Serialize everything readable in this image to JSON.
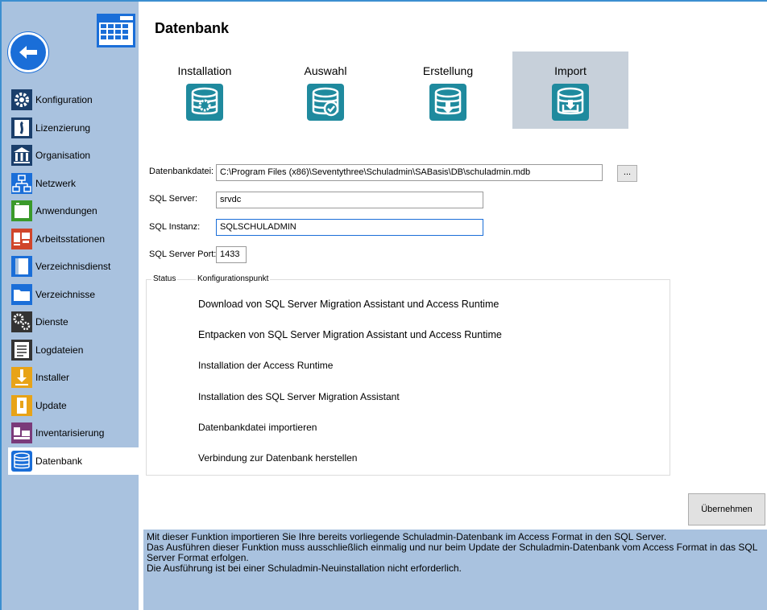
{
  "sidebar": {
    "back_icon": "back-arrow-icon",
    "calendar_icon": "calendar-icon",
    "items": [
      {
        "label": "Konfiguration",
        "icon": "gear-icon",
        "color": "#1a3e6b"
      },
      {
        "label": "Lizenzierung",
        "icon": "license-icon",
        "color": "#1a3e6b"
      },
      {
        "label": "Organisation",
        "icon": "building-icon",
        "color": "#1a3e6b"
      },
      {
        "label": "Netzwerk",
        "icon": "network-icon",
        "color": "#1a6ed8"
      },
      {
        "label": "Anwendungen",
        "icon": "application-window-icon",
        "color": "#3a9a2a"
      },
      {
        "label": "Arbeitsstationen",
        "icon": "workstation-icon",
        "color": "#d0452a"
      },
      {
        "label": "Verzeichnisdienst",
        "icon": "directory-service-icon",
        "color": "#1a6ed8"
      },
      {
        "label": "Verzeichnisse",
        "icon": "folder-icon",
        "color": "#1a6ed8"
      },
      {
        "label": "Dienste",
        "icon": "services-gears-icon",
        "color": "#333333"
      },
      {
        "label": "Logdateien",
        "icon": "log-file-icon",
        "color": "#333333"
      },
      {
        "label": "Installer",
        "icon": "installer-icon",
        "color": "#e8a317"
      },
      {
        "label": "Update",
        "icon": "update-icon",
        "color": "#e8a317"
      },
      {
        "label": "Inventarisierung",
        "icon": "inventory-icon",
        "color": "#7a3a7a"
      },
      {
        "label": "Datenbank",
        "icon": "database-icon",
        "color": "#1a6ed8"
      }
    ],
    "active_index": 13
  },
  "main": {
    "title": "Datenbank",
    "tabs": [
      {
        "label": "Installation",
        "icon": "database-gear-icon"
      },
      {
        "label": "Auswahl",
        "icon": "database-check-icon"
      },
      {
        "label": "Erstellung",
        "icon": "database-create-icon"
      },
      {
        "label": "Import",
        "icon": "database-import-icon"
      }
    ],
    "active_tab": "Import",
    "form": {
      "db_file_label": "Datenbankdatei:",
      "db_file_value": "C:\\Program Files (x86)\\Seventythree\\Schuladmin\\SABasis\\DB\\schuladmin.mdb",
      "browse_label": "...",
      "server_label": "SQL Server:",
      "server_value": "srvdc",
      "instance_label": "SQL Instanz:",
      "instance_value": "SQLSCHULADMIN",
      "port_label": "SQL Server Port:",
      "port_value": "1433"
    },
    "status_group": {
      "col_status": "Status",
      "col_point": "Konfigurationspunkt",
      "steps": [
        "Download von SQL Server Migration Assistant und Access Runtime",
        "Entpacken von SQL Server Migration Assistant und Access Runtime",
        "Installation der Access Runtime",
        "Installation des SQL Server Migration Assistant",
        "Datenbankdatei importieren",
        "Verbindung zur Datenbank herstellen"
      ]
    },
    "apply_label": "Übernehmen",
    "info_lines": [
      "Mit dieser Funktion importieren Sie Ihre bereits vorliegende Schuladmin-Datenbank im Access Format in den SQL Server.",
      "Das Ausführen dieser Funktion muss ausschließlich einmalig und nur beim Update der Schuladmin-Datenbank vom Access Format in das SQL Server Format erfolgen.",
      "Die Ausführung ist bei einer Schuladmin-Neuinstallation nicht erforderlich."
    ]
  },
  "colors": {
    "sidebar_bg": "#a9c2df",
    "accent": "#1a6ed8",
    "db_icon_teal": "#1f8a9e",
    "active_tab_bg": "#c7d0da"
  }
}
